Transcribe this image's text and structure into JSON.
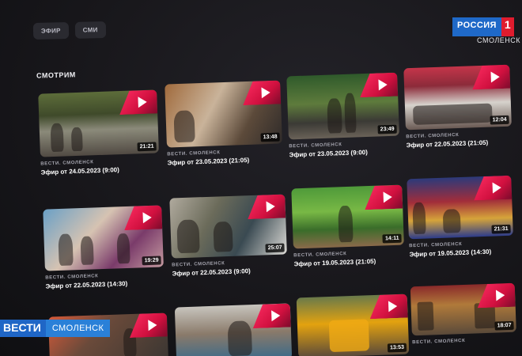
{
  "tabs": [
    {
      "label": "ЭФИР"
    },
    {
      "label": "СМИ"
    }
  ],
  "section_title": "СМОТРИМ",
  "channel": {
    "name": "РОССИЯ",
    "number": "1",
    "city": "СМОЛЕНСК"
  },
  "strap": {
    "program": "ВЕСТИ",
    "city": "СМОЛЕНСК"
  },
  "videos": [
    {
      "duration": "21:21",
      "source": "ВЕСТИ. СМОЛЕНСК",
      "date": "Эфир от 24.05.2023 (9:00)"
    },
    {
      "duration": "13:48",
      "source": "ВЕСТИ. СМОЛЕНСК",
      "date": "Эфир от 23.05.2023 (21:05)"
    },
    {
      "duration": "23:49",
      "source": "ВЕСТИ. СМОЛЕНСК",
      "date": "Эфир от 23.05.2023 (9:00)"
    },
    {
      "duration": "12:04",
      "source": "ВЕСТИ. СМОЛЕНСК",
      "date": "Эфир от 22.05.2023 (21:05)"
    },
    {
      "duration": "19:29",
      "source": "ВЕСТИ. СМОЛЕНСК",
      "date": "Эфир от 22.05.2023 (14:30)"
    },
    {
      "duration": "25:07",
      "source": "ВЕСТИ. СМОЛЕНСК",
      "date": "Эфир от 22.05.2023 (9:00)"
    },
    {
      "duration": "14:11",
      "source": "ВЕСТИ. СМОЛЕНСК",
      "date": "Эфир от 19.05.2023 (21:05)"
    },
    {
      "duration": "21:31",
      "source": "ВЕСТИ. СМОЛЕНСК",
      "date": "Эфир от 19.05.2023 (14:30)"
    },
    {
      "duration": "",
      "source": "",
      "date": ""
    },
    {
      "duration": "",
      "source": "",
      "date": ""
    },
    {
      "duration": "13:53",
      "source": "",
      "date": ""
    },
    {
      "duration": "18:07",
      "source": "ВЕСТИ. СМОЛЕНСК",
      "date": ""
    }
  ]
}
